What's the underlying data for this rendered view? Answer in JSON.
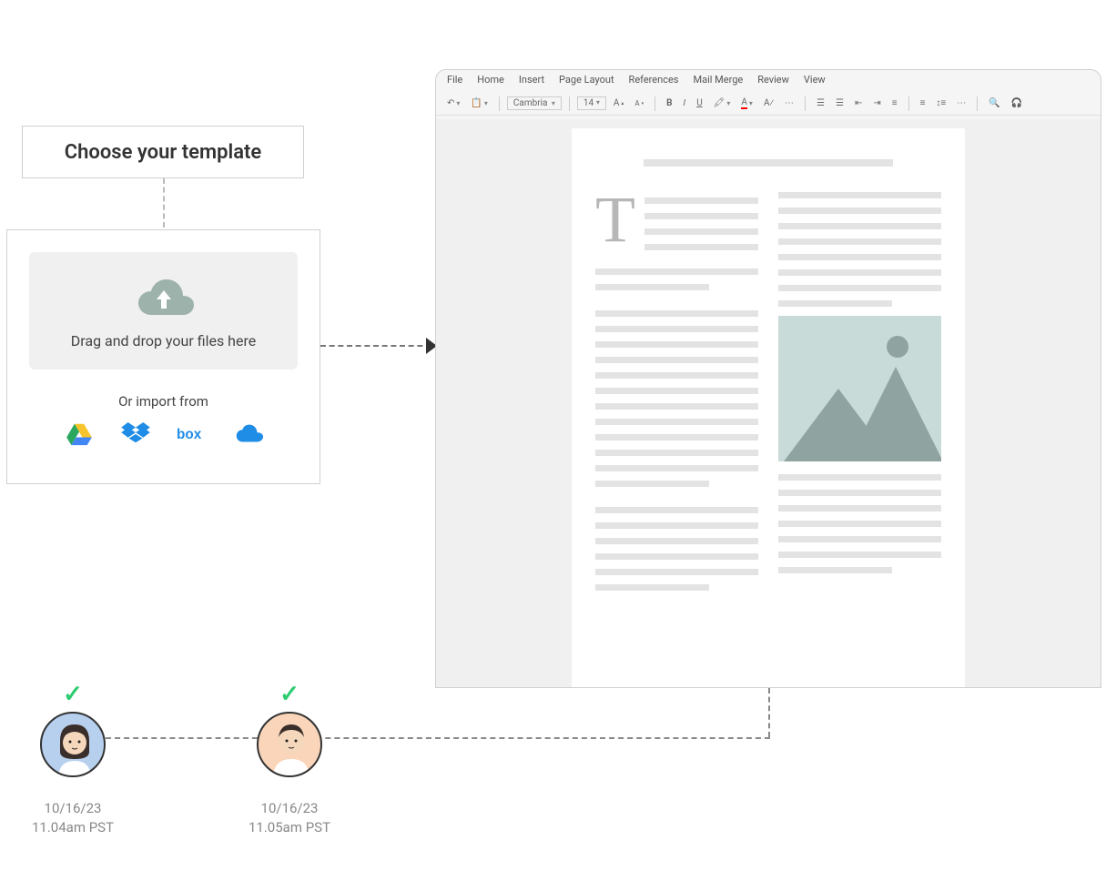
{
  "template_box": {
    "title": "Choose your template"
  },
  "upload": {
    "drop_text": "Drag and drop your files here",
    "import_label": "Or import from",
    "sources": [
      "google-drive",
      "dropbox",
      "box",
      "onedrive"
    ]
  },
  "editor": {
    "menu": [
      "File",
      "Home",
      "Insert",
      "Page Layout",
      "References",
      "Mail Merge",
      "Review",
      "View"
    ],
    "font_name": "Cambria",
    "font_size": "14",
    "dropcap": "T"
  },
  "approvals": [
    {
      "date_line1": "10/16/23",
      "date_line2": "11.04am PST"
    },
    {
      "date_line1": "10/16/23",
      "date_line2": "11.05am PST"
    }
  ]
}
